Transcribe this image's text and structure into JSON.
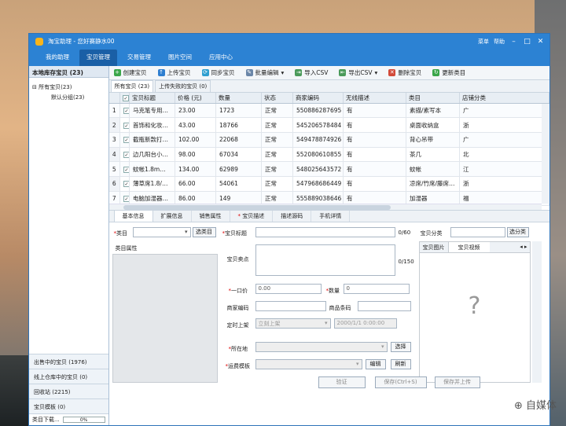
{
  "window": {
    "title": "淘宝助理 - 您好赛静水00",
    "menu": "菜单",
    "help": "帮助"
  },
  "nav": [
    "我的助理",
    "宝贝管理",
    "交易管理",
    "图片空间",
    "应用中心"
  ],
  "left": {
    "header": "本地库存宝贝 (23)",
    "tree": [
      "所有宝贝(23)",
      "默认分组(23)"
    ],
    "bottom": [
      "出售中的宝贝 (1976)",
      "线上仓库中的宝贝 (0)",
      "回收站 (2215)",
      "宝贝模板 (0)"
    ],
    "status": "类目下载...",
    "progress": "0%"
  },
  "toolbar": [
    "创建宝贝",
    "上传宝贝",
    "同步宝贝",
    "批量编辑",
    "导入CSV",
    "导出CSV",
    "删除宝贝",
    "更新类目"
  ],
  "subtabs": [
    "所有宝贝 (23)",
    "上传失败的宝贝 (0)"
  ],
  "columns": [
    "宝贝标题",
    "价格 (元)",
    "数量",
    "状态",
    "商家编码",
    "无线描述",
    "类目",
    "店铺分类"
  ],
  "rows": [
    [
      "1",
      "马克笔专用…",
      "23.00",
      "1723",
      "正常",
      "550886287695",
      "有",
      "素描/素写本",
      "广"
    ],
    [
      "2",
      "首饰和化妆…",
      "43.00",
      "18766",
      "正常",
      "545206578484",
      "有",
      "桌面收纳盒",
      "浙"
    ],
    [
      "3",
      "截瓶新款打…",
      "102.00",
      "22068",
      "正常",
      "549478874926",
      "有",
      "背心吊带",
      "广"
    ],
    [
      "4",
      "边几阳台小…",
      "98.00",
      "67034",
      "正常",
      "552080610855",
      "有",
      "茶几",
      "北"
    ],
    [
      "5",
      "蚊帐1.8m…",
      "134.00",
      "62989",
      "正常",
      "548025643572",
      "有",
      "蚊帐",
      "江"
    ],
    [
      "6",
      "薄草席1.8/…",
      "66.00",
      "54061",
      "正常",
      "547968686449",
      "有",
      "凉席/竹席/藤席…",
      "浙"
    ],
    [
      "7",
      "电脑加湿器…",
      "86.00",
      "149",
      "正常",
      "555889038646",
      "有",
      "加湿器",
      "福"
    ]
  ],
  "detail_tabs": [
    "基本信息",
    "扩展信息",
    "销售属性",
    "宝贝描述",
    "描述源码",
    "手机详情"
  ],
  "form": {
    "category": "类目",
    "select_cat": "选类目",
    "cat_attr": "类目属性",
    "title": "宝贝标题",
    "title_count": "0/60",
    "selling": "宝贝卖点",
    "selling_count": "0/150",
    "price": "一口价",
    "price_val": "0.00",
    "qty": "数量",
    "qty_val": "0",
    "merchant_code": "商家编码",
    "barcode": "商品条码",
    "schedule": "定时上架",
    "schedule_opt": "立刻上架",
    "schedule_date": "2000/1/1 0:00:00",
    "location": "所在地",
    "choose": "选择",
    "shipping": "运费模板",
    "edit": "编辑",
    "refresh": "刷新",
    "shop_cat": "宝贝分类",
    "select_shop_cat": "选分类",
    "img_tab": "宝贝图片",
    "video_tab": "宝贝视频",
    "question": "?",
    "verify": "验证",
    "save": "保存(Ctrl+S)",
    "save_upload": "保存并上传"
  },
  "watermark": "自媒体"
}
